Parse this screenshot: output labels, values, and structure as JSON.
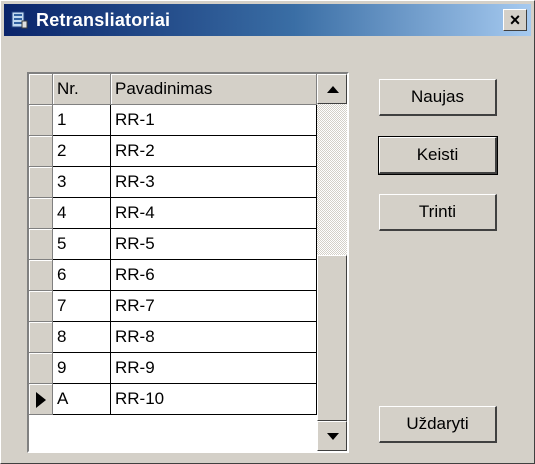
{
  "window": {
    "title": "Retransliatoriai",
    "close_label": "×"
  },
  "grid": {
    "columns": [
      "Nr.",
      "Pavadinimas"
    ],
    "rows": [
      {
        "nr": "1",
        "name": "RR-1"
      },
      {
        "nr": "2",
        "name": "RR-2"
      },
      {
        "nr": "3",
        "name": "RR-3"
      },
      {
        "nr": "4",
        "name": "RR-4"
      },
      {
        "nr": "5",
        "name": "RR-5"
      },
      {
        "nr": "6",
        "name": "RR-6"
      },
      {
        "nr": "7",
        "name": "RR-7"
      },
      {
        "nr": "8",
        "name": "RR-8"
      },
      {
        "nr": "9",
        "name": "RR-9"
      },
      {
        "nr": "A",
        "name": "RR-10"
      }
    ],
    "current_row_index": 9
  },
  "buttons": {
    "new": "Naujas",
    "edit": "Keisti",
    "delete": "Trinti",
    "close": "Uždaryti"
  }
}
